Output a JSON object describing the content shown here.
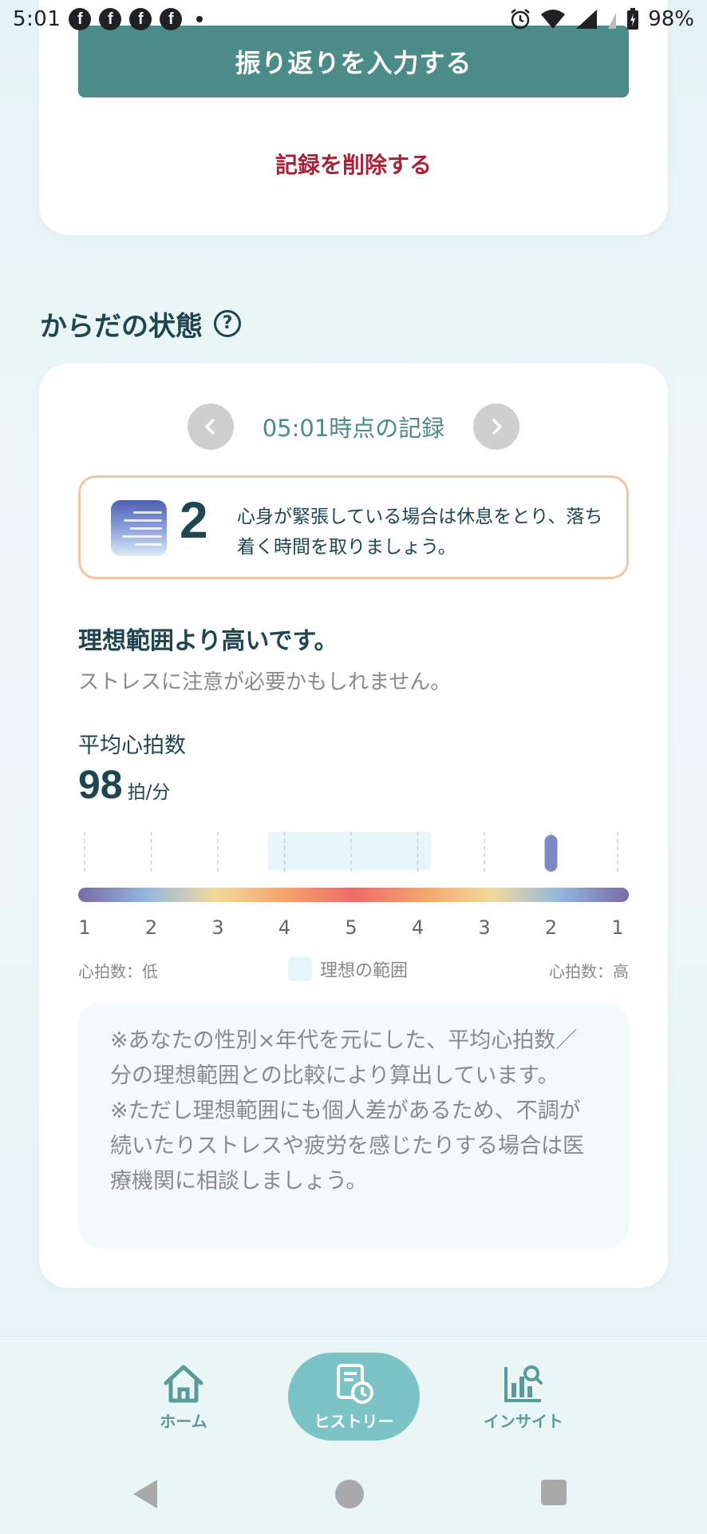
{
  "status_bar": {
    "time": "5:01",
    "battery": "98%"
  },
  "top_card": {
    "primary_button": "振り返りを入力する",
    "delete_link": "記録を削除する"
  },
  "section": {
    "title": "からだの状態",
    "help_glyph": "?"
  },
  "record_nav": {
    "label": "05:01時点の記録",
    "prev_glyph": "‹",
    "next_glyph": "›"
  },
  "score": {
    "value": "2",
    "message": "心身が緊張している場合は休息をとり、落ち着く時間を取りましょう。",
    "accent_border": "#f2c7a1"
  },
  "status": {
    "headline": "理想範囲より高いです。",
    "subline": "ストレスに注意が必要かもしれません。"
  },
  "heart_rate": {
    "label": "平均心拍数",
    "value": "98",
    "unit": "拍/分"
  },
  "gauge": {
    "tick_labels": [
      "1",
      "2",
      "3",
      "4",
      "5",
      "4",
      "3",
      "2",
      "1"
    ],
    "ideal_from_index": 2.75,
    "ideal_to_index": 5.2,
    "marker_index": 7,
    "low_label": "心拍数：低",
    "ideal_label": "理想の範囲",
    "high_label": "心拍数：高",
    "gradient_colors": [
      "#7a6aa6",
      "#93b7df",
      "#f4d99a",
      "#f5a36b",
      "#f06a6a",
      "#f5a36b",
      "#f4d99a",
      "#93b7df",
      "#7a6aa6"
    ],
    "marker_color": "#7e88c4",
    "ideal_color": "#e7f6fb"
  },
  "note": {
    "line1": "※あなたの性別×年代を元にした、平均心拍数／分の理想範囲との比較により算出しています。",
    "line2": "※ただし理想範囲にも個人差があるため、不調が続いたりストレスや疲労を感じたりする場合は医療機関に相談しましょう。"
  },
  "bottom_nav": {
    "home": "ホーム",
    "history": "ヒストリー",
    "insight": "インサイト"
  },
  "colors": {
    "brand_teal": "#4b8b88",
    "delete_red": "#a5243a",
    "nav_active": "#7cc3c5"
  }
}
